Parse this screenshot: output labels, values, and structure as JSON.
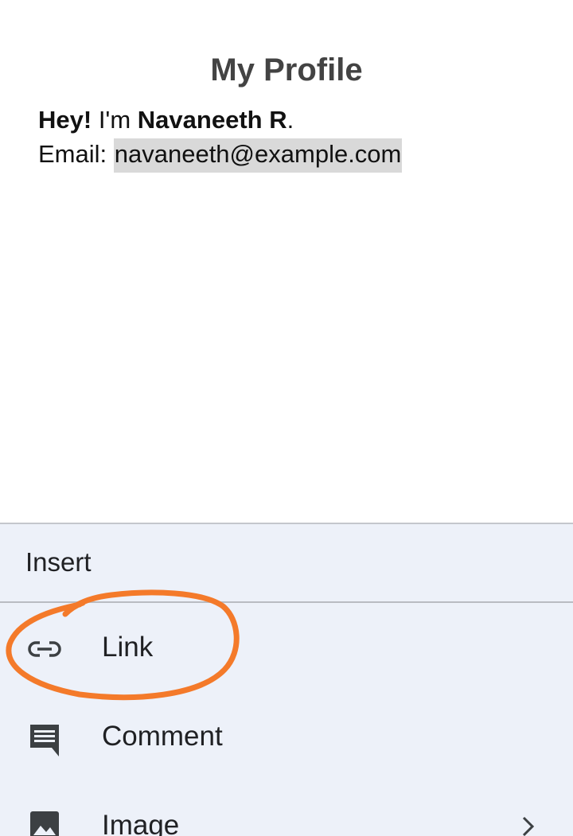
{
  "document": {
    "title": "My Profile",
    "greeting_bold": "Hey!",
    "greeting_text": " I'm ",
    "name": "Navaneeth R",
    "name_suffix": ".",
    "email_label": "Email: ",
    "email_value": "navaneeth@example.com"
  },
  "insert_menu": {
    "title": "Insert",
    "items": [
      {
        "label": "Link",
        "icon": "link-icon"
      },
      {
        "label": "Comment",
        "icon": "comment-icon"
      },
      {
        "label": "Image",
        "icon": "image-icon",
        "has_submenu": true
      }
    ]
  },
  "colors": {
    "sheet_background": "#edf1f9",
    "annotation": "#f47a2a",
    "email_highlight": "#d9d9d9"
  }
}
